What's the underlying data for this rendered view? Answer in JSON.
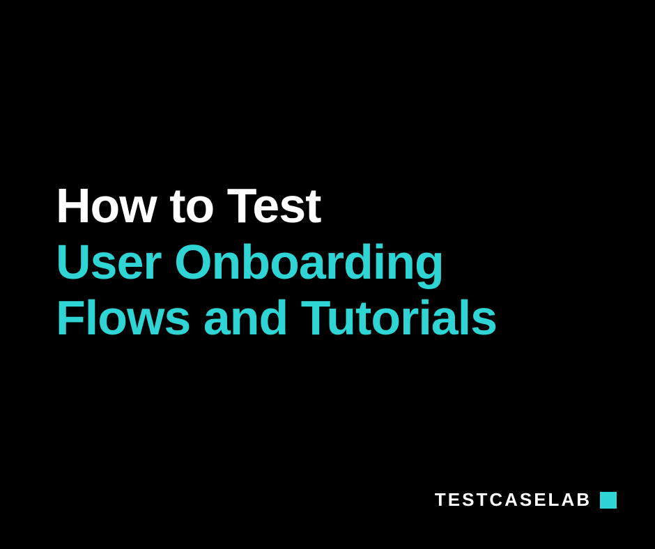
{
  "title": {
    "line1": "How to Test",
    "line2": "User Onboarding",
    "line3": "Flows and Tutorials"
  },
  "brand": {
    "name": "TESTCASELAB"
  }
}
